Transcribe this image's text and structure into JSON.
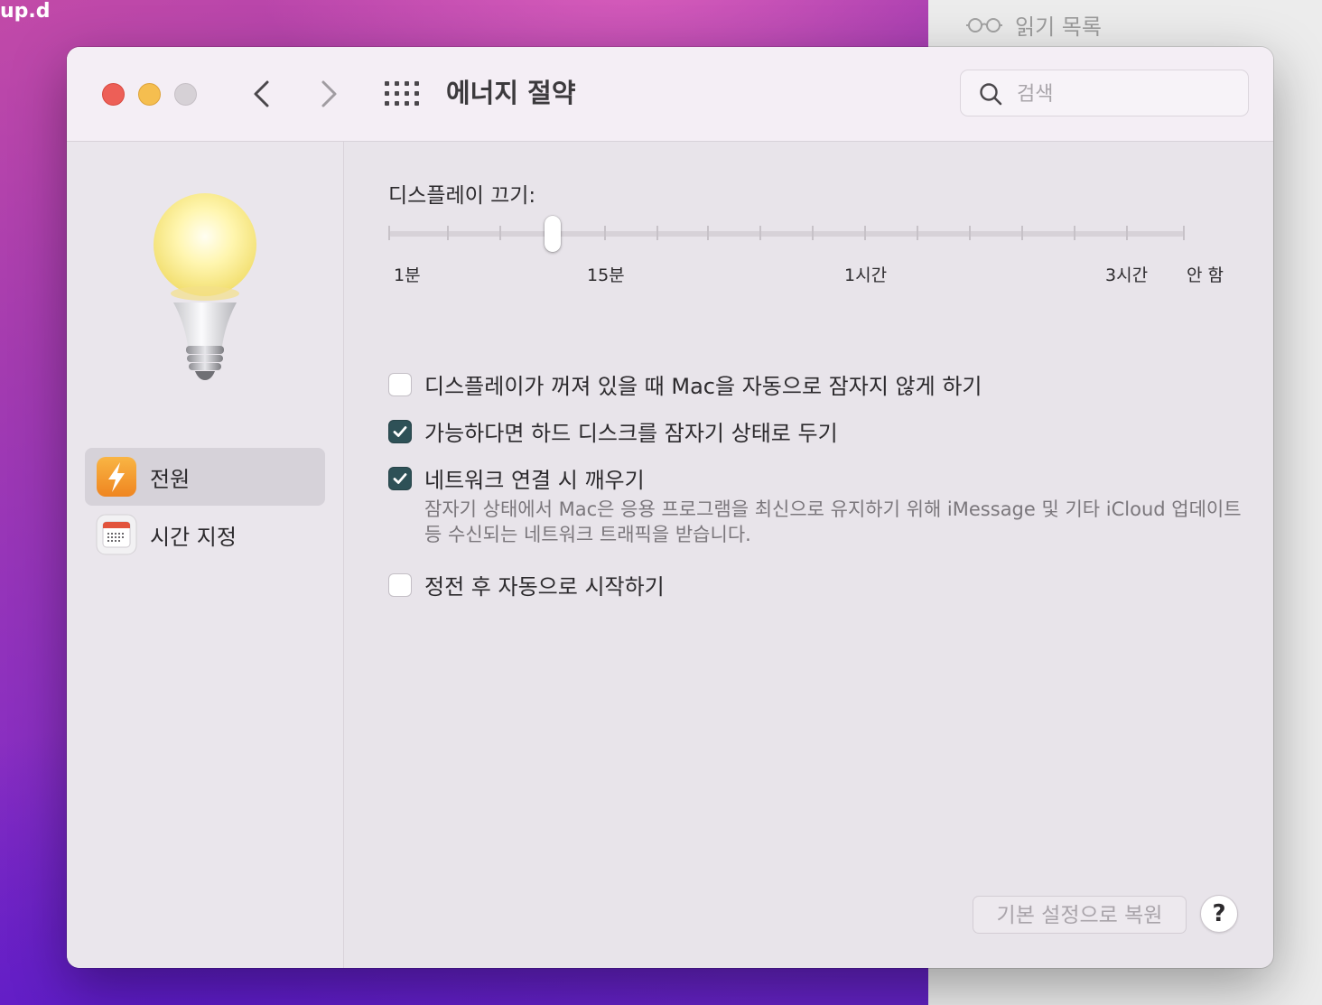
{
  "desktop": {
    "label": "up.d"
  },
  "background_window": {
    "reading_list_label": "읽기 목록",
    "reading_list_icon": "glasses-icon"
  },
  "window": {
    "title": "에너지 절약",
    "search": {
      "placeholder": "검색",
      "value": ""
    }
  },
  "sidebar": {
    "items": [
      {
        "label": "전원",
        "icon": "power-icon",
        "selected": true
      },
      {
        "label": "시간 지정",
        "icon": "calendar-icon",
        "selected": false
      }
    ]
  },
  "display_sleep": {
    "label": "디스플레이 끄기:",
    "tick_labels": [
      "1분",
      "15분",
      "1시간",
      "3시간",
      "안 함"
    ],
    "selected_value": "10분"
  },
  "options": [
    {
      "label": "디스플레이가 꺼져 있을 때 Mac을 자동으로 잠자지 않게 하기",
      "checked": false
    },
    {
      "label": "가능하다면 하드 디스크를 잠자기 상태로 두기",
      "checked": true
    },
    {
      "label": "네트워크 연결 시 깨우기",
      "checked": true
    },
    {
      "label": "정전 후 자동으로 시작하기",
      "checked": false
    }
  ],
  "network_wake_note": "잠자기 상태에서 Mac은 응용 프로그램을 최신으로 유지하기 위해 iMessage 및 기타 iCloud 업데이트 등 수신되는 네트워크 트래픽을 받습니다.",
  "buttons": {
    "restore_defaults": "기본 설정으로 복원",
    "help": "?"
  },
  "colors": {
    "checkbox_on": "#2e5157",
    "close": "#ed5f57",
    "minimize": "#f5be4f",
    "zoom": "#d6d1d6",
    "power_icon": "#f39a2b"
  }
}
